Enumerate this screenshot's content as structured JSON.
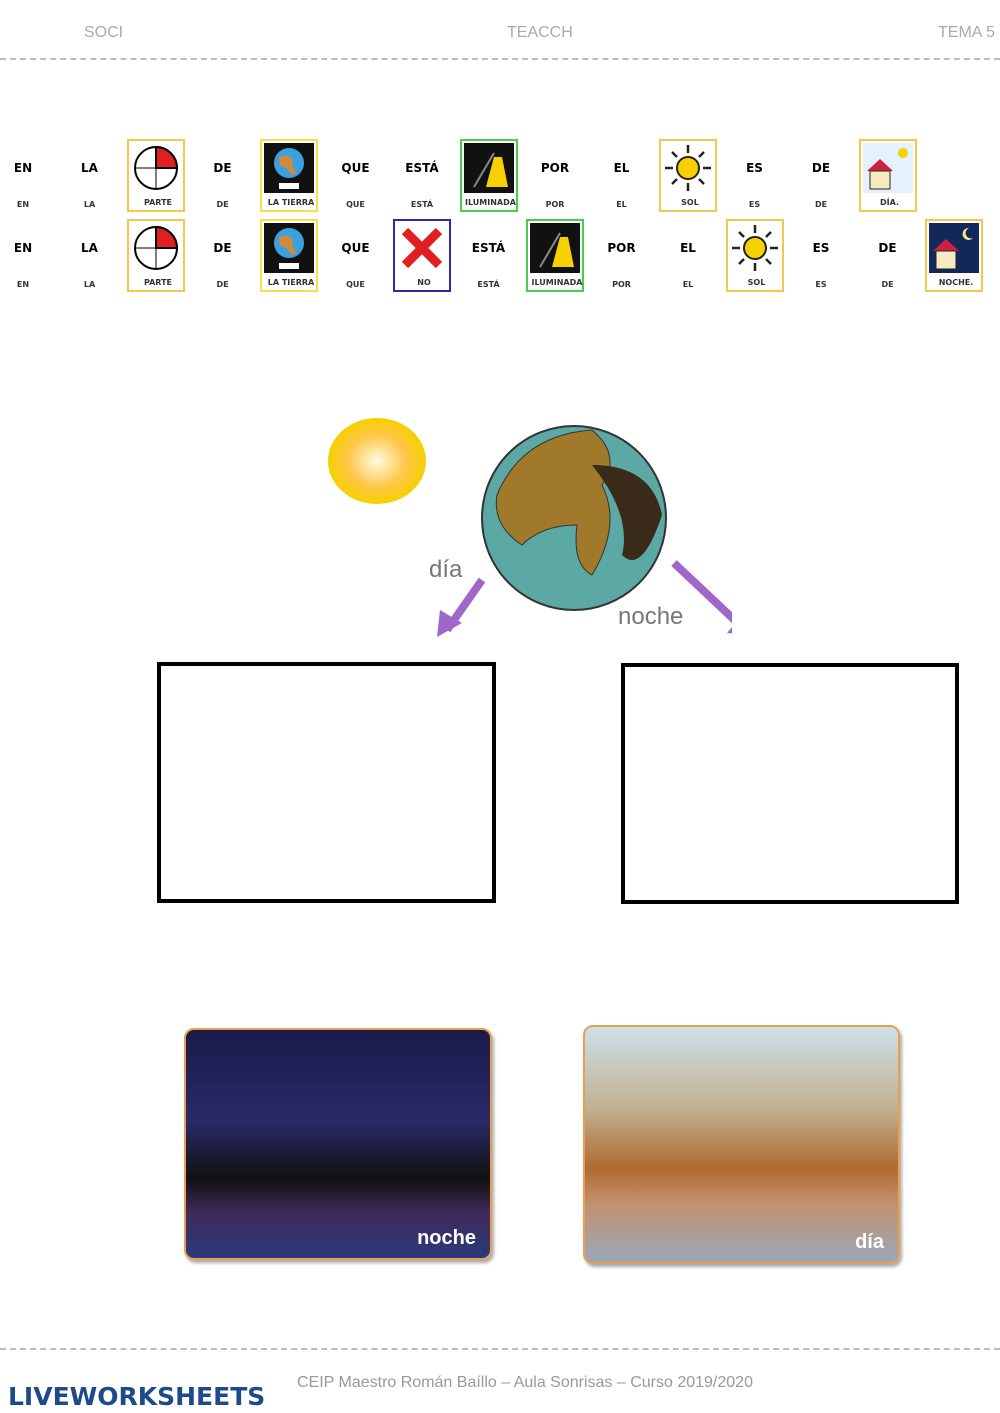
{
  "header": {
    "left": "SOCI",
    "center": "TEACCH",
    "right": "TEMA 5"
  },
  "sentences": [
    [
      {
        "w": "EN"
      },
      {
        "w": "LA"
      },
      {
        "card": "PARTE",
        "icon": "quarter-circle-icon",
        "border": "#f3c84c"
      },
      {
        "w": "DE"
      },
      {
        "card": "LA TIERRA",
        "icon": "earth-icon",
        "border": "#f3e04c"
      },
      {
        "w": "QUE"
      },
      {
        "w": "ESTÁ"
      },
      {
        "card": "ILUMINADA",
        "icon": "lamp-icon",
        "border": "#4ccc4c"
      },
      {
        "w": "POR"
      },
      {
        "w": "EL"
      },
      {
        "card": "SOL",
        "icon": "sun-icon",
        "border": "#f3c84c"
      },
      {
        "w": "ES"
      },
      {
        "w": "DE"
      },
      {
        "card": "DÍA.",
        "icon": "house-day-icon",
        "border": "#f3c84c"
      }
    ],
    [
      {
        "w": "EN"
      },
      {
        "w": "LA"
      },
      {
        "card": "PARTE",
        "icon": "quarter-circle-icon",
        "border": "#f3c84c"
      },
      {
        "w": "DE"
      },
      {
        "card": "LA TIERRA",
        "icon": "earth-icon",
        "border": "#f3e04c"
      },
      {
        "w": "QUE"
      },
      {
        "card": "NO",
        "icon": "red-x-icon",
        "border": "#2a2aa8"
      },
      {
        "w": "ESTÁ"
      },
      {
        "card": "ILUMINADA",
        "icon": "lamp-icon",
        "border": "#4ccc4c"
      },
      {
        "w": "POR"
      },
      {
        "w": "EL"
      },
      {
        "card": "SOL",
        "icon": "sun-icon",
        "border": "#f3c84c"
      },
      {
        "w": "ES"
      },
      {
        "w": "DE"
      },
      {
        "card": "NOCHE.",
        "icon": "house-night-icon",
        "border": "#f3c84c"
      }
    ]
  ],
  "illustration": {
    "day_label": "día",
    "night_label": "noche"
  },
  "photos": {
    "night": "noche",
    "day": "día"
  },
  "footer": {
    "logo": "LIVEWORKSHEETS",
    "text": "CEIP Maestro Román Baíllo  – Aula Sonrisas  –  Curso 2019/2020"
  }
}
